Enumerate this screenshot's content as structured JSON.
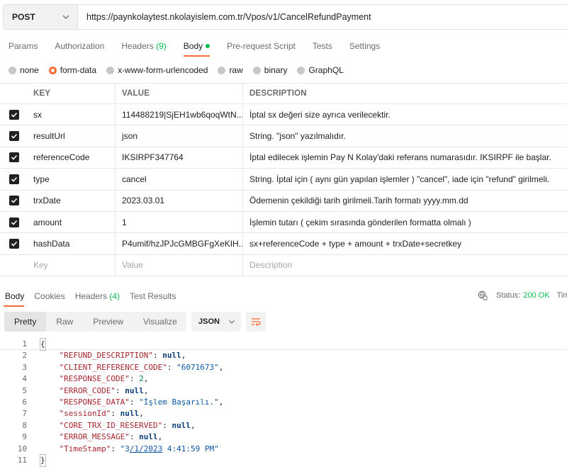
{
  "request": {
    "method": "POST",
    "url": "https://paynkolaytest.nkolayislem.com.tr/Vpos/v1/CancelRefundPayment"
  },
  "request_tabs": [
    {
      "label": "Params",
      "count": ""
    },
    {
      "label": "Authorization",
      "count": ""
    },
    {
      "label": "Headers",
      "count": "(9)"
    },
    {
      "label": "Body",
      "count": ""
    },
    {
      "label": "Pre-request Script",
      "count": ""
    },
    {
      "label": "Tests",
      "count": ""
    },
    {
      "label": "Settings",
      "count": ""
    }
  ],
  "body_types": [
    "none",
    "form-data",
    "x-www-form-urlencoded",
    "raw",
    "binary",
    "GraphQL"
  ],
  "table": {
    "headers": {
      "key": "KEY",
      "value": "VALUE",
      "description": "DESCRIPTION"
    },
    "rows": [
      {
        "key": "sx",
        "value": "114488219|SjEH1wb6qoqWtN...",
        "description": "İptal sx değeri size ayrıca verilecektir."
      },
      {
        "key": "resultUrl",
        "value": "json",
        "description": "String. \"json\" yazılmalıdır."
      },
      {
        "key": "referenceCode",
        "value": "IKSIRPF347764",
        "description": "İptal edilecek işlemin Pay N Kolay'daki referans numarasıdır. IKSIRPF ile başlar."
      },
      {
        "key": "type",
        "value": "cancel",
        "description": "String. İptal için ( aynı gün yapılan işlemler ) \"cancel\", iade için \"refund\" girilmeli."
      },
      {
        "key": "trxDate",
        "value": "2023.03.01",
        "description": "Ödemenin çekildiği tarih girilmeli.Tarih formatı yyyy.mm.dd"
      },
      {
        "key": "amount",
        "value": "1",
        "description": "İşlemin tutarı ( çekim sırasında gönderilen formatta olmalı )"
      },
      {
        "key": "hashData",
        "value": "P4umif/hzJPJcGMBGFgXeKIH...",
        "description": "sx+referenceCode + type + amount + trxDate+secretkey"
      }
    ],
    "placeholder": {
      "key": "Key",
      "value": "Value",
      "description": "Description"
    }
  },
  "response_tabs": [
    {
      "label": "Body",
      "count": ""
    },
    {
      "label": "Cookies",
      "count": ""
    },
    {
      "label": "Headers",
      "count": "(4)"
    },
    {
      "label": "Test Results",
      "count": ""
    }
  ],
  "status": {
    "label": "Status:",
    "value": "200 OK",
    "time_label": "Tim"
  },
  "view_modes": [
    "Pretty",
    "Raw",
    "Preview",
    "Visualize"
  ],
  "format": "JSON",
  "code": {
    "line_numbers": [
      "1",
      "2",
      "3",
      "4",
      "5",
      "6",
      "7",
      "8",
      "9",
      "10",
      "11"
    ],
    "entries": [
      {
        "key": "\"REFUND_DESCRIPTION\"",
        "value": "null",
        "type": "null"
      },
      {
        "key": "\"CLIENT_REFERENCE_CODE\"",
        "value": "\"6071673\"",
        "type": "string"
      },
      {
        "key": "\"RESPONSE_CODE\"",
        "value": "2",
        "type": "number"
      },
      {
        "key": "\"ERROR_CODE\"",
        "value": "null",
        "type": "null"
      },
      {
        "key": "\"RESPONSE_DATA\"",
        "value": "\"İşlem Başarılı.\"",
        "type": "string"
      },
      {
        "key": "\"sessionId\"",
        "value": "null",
        "type": "null"
      },
      {
        "key": "\"CORE_TRX_ID_RESERVED\"",
        "value": "null",
        "type": "null"
      },
      {
        "key": "\"ERROR_MESSAGE\"",
        "value": "null",
        "type": "null"
      },
      {
        "key": "\"TimeStamp\"",
        "value_pre": "\"3",
        "value_ul": "/1/2023",
        "value_post": " 4:41:59 PM\"",
        "type": "string"
      }
    ]
  }
}
